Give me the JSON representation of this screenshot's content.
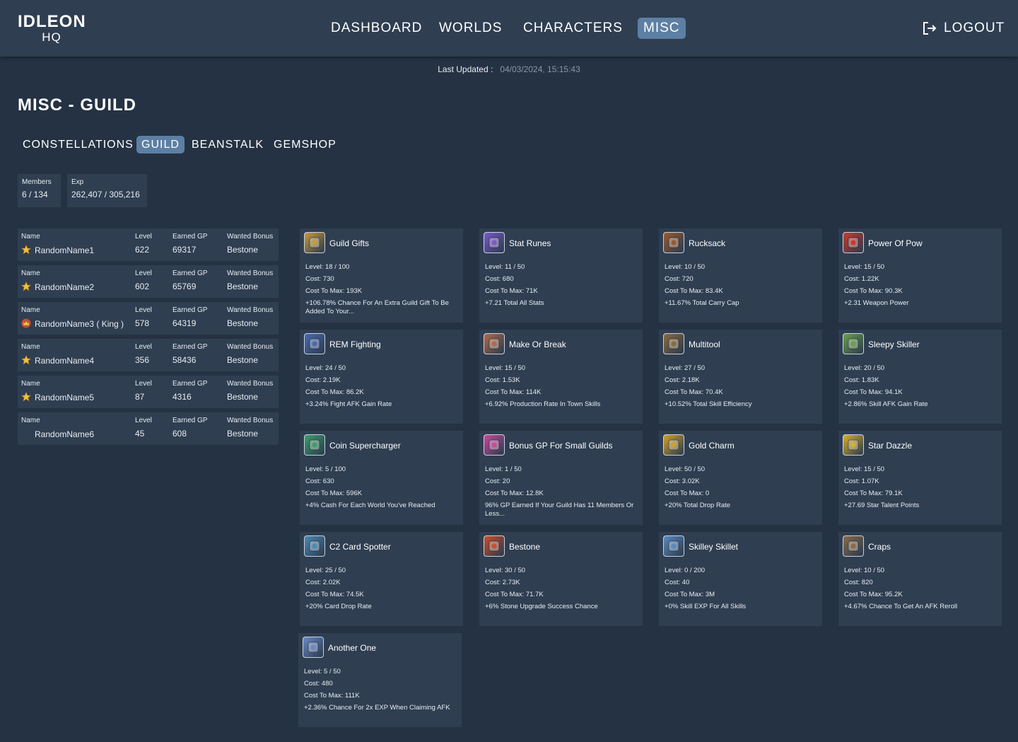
{
  "app": {
    "logo_line1": "IDLEON",
    "logo_line2": "HQ"
  },
  "nav": {
    "items": [
      "DASHBOARD",
      "WORLDS",
      "CHARACTERS",
      "MISC"
    ],
    "active": "MISC",
    "logout": "LOGOUT"
  },
  "last_updated": {
    "label": "Last Updated :",
    "value": "04/03/2024, 15:15:43"
  },
  "page_title": "MISC - GUILD",
  "subtabs": {
    "items": [
      "CONSTELLATIONS",
      "GUILD",
      "BEANSTALK",
      "GEMSHOP"
    ],
    "active": "GUILD"
  },
  "guild_stats": {
    "members_label": "Members",
    "members_value": "6 / 134",
    "exp_label": "Exp",
    "exp_value": "262,407 / 305,216"
  },
  "member_headers": {
    "name": "Name",
    "level": "Level",
    "gp": "Earned GP",
    "bonus": "Wanted Bonus"
  },
  "members": [
    {
      "name": "RandomName1",
      "level": "622",
      "gp": "69317",
      "bonus": "Bestone",
      "rank_icon": "star-icon"
    },
    {
      "name": "RandomName2",
      "level": "602",
      "gp": "65769",
      "bonus": "Bestone",
      "rank_icon": "star-icon"
    },
    {
      "name": "RandomName3 ( King )",
      "level": "578",
      "gp": "64319",
      "bonus": "Bestone",
      "rank_icon": "crown-icon"
    },
    {
      "name": "RandomName4",
      "level": "356",
      "gp": "58436",
      "bonus": "Bestone",
      "rank_icon": "star-icon"
    },
    {
      "name": "RandomName5",
      "level": "87",
      "gp": "4316",
      "bonus": "Bestone",
      "rank_icon": "star-icon"
    },
    {
      "name": "RandomName6",
      "level": "45",
      "gp": "608",
      "bonus": "Bestone",
      "rank_icon": ""
    }
  ],
  "bonuses": [
    {
      "name": "Guild Gifts",
      "level": "Level: 18 / 100",
      "cost": "Cost: 730",
      "cost_to_max": "Cost To Max: 193K",
      "effect": "+106.78% Chance For An Extra Guild Gift To Be Added To Your...",
      "icon": "gift-box-icon",
      "color": "#c99a3a"
    },
    {
      "name": "Stat Runes",
      "level": "Level: 11 / 50",
      "cost": "Cost: 680",
      "cost_to_max": "Cost To Max: 71K",
      "effect": "+7.21 Total All Stats",
      "icon": "rune-stones-icon",
      "color": "#7a5ac8"
    },
    {
      "name": "Rucksack",
      "level": "Level: 10 / 50",
      "cost": "Cost: 720",
      "cost_to_max": "Cost To Max: 83.4K",
      "effect": "+11.67% Total Carry Cap",
      "icon": "backpack-icon",
      "color": "#9a5a2e"
    },
    {
      "name": "Power Of Pow",
      "level": "Level: 15 / 50",
      "cost": "Cost: 1.22K",
      "cost_to_max": "Cost To Max: 90.3K",
      "effect": "+2.31 Weapon Power",
      "icon": "fist-power-icon",
      "color": "#c83a2e"
    },
    {
      "name": "REM Fighting",
      "level": "Level: 24 / 50",
      "cost": "Cost: 2.19K",
      "cost_to_max": "Cost To Max: 86.2K",
      "effect": "+3.24% Fight AFK Gain Rate",
      "icon": "crossed-swords-icon",
      "color": "#4a6ab0"
    },
    {
      "name": "Make Or Break",
      "level": "Level: 15 / 50",
      "cost": "Cost: 1.53K",
      "cost_to_max": "Cost To Max: 114K",
      "effect": "+6.92% Production Rate In Town Skills",
      "icon": "anvil-icon",
      "color": "#b06a4a"
    },
    {
      "name": "Multitool",
      "level": "Level: 27 / 50",
      "cost": "Cost: 2.18K",
      "cost_to_max": "Cost To Max: 70.4K",
      "effect": "+10.52% Total Skill Efficiency",
      "icon": "tools-icon",
      "color": "#8a6a3a"
    },
    {
      "name": "Sleepy Skiller",
      "level": "Level: 20 / 50",
      "cost": "Cost: 1.83K",
      "cost_to_max": "Cost To Max: 94.1K",
      "effect": "+2.86% Skill AFK Gain Rate",
      "icon": "sleep-icon",
      "color": "#6aa04a"
    },
    {
      "name": "Coin Supercharger",
      "level": "Level: 5 / 100",
      "cost": "Cost: 630",
      "cost_to_max": "Cost To Max: 596K",
      "effect": "+4% Cash For Each World You've Reached",
      "icon": "coins-icon",
      "color": "#3aa06a"
    },
    {
      "name": "Bonus GP For Small Guilds",
      "level": "Level: 1 / 50",
      "cost": "Cost: 20",
      "cost_to_max": "Cost To Max: 12.8K",
      "effect": "96% GP Earned If Your Guild Has 11 Members Or Less...",
      "icon": "group-icon",
      "color": "#c84a9a"
    },
    {
      "name": "Gold Charm",
      "level": "Level: 50 / 50",
      "cost": "Cost: 3.02K",
      "cost_to_max": "Cost To Max: 0",
      "effect": "+20% Total Drop Rate",
      "icon": "clover-charm-icon",
      "color": "#d0a02a"
    },
    {
      "name": "Star Dazzle",
      "level": "Level: 15 / 50",
      "cost": "Cost: 1.07K",
      "cost_to_max": "Cost To Max: 79.1K",
      "effect": "+27.69 Star Talent Points",
      "icon": "stars-icon",
      "color": "#d8b02a"
    },
    {
      "name": "C2 Card Spotter",
      "level": "Level: 25 / 50",
      "cost": "Cost: 2.02K",
      "cost_to_max": "Cost To Max: 74.5K",
      "effect": "+20% Card Drop Rate",
      "icon": "cards-icon",
      "color": "#4a8ab0"
    },
    {
      "name": "Bestone",
      "level": "Level: 30 / 50",
      "cost": "Cost: 2.73K",
      "cost_to_max": "Cost To Max: 71.7K",
      "effect": "+6% Stone Upgrade Success Chance",
      "icon": "stone-icon",
      "color": "#c8502e"
    },
    {
      "name": "Skilley Skillet",
      "level": "Level: 0 / 200",
      "cost": "Cost: 40",
      "cost_to_max": "Cost To Max: 3M",
      "effect": "+0% Skill EXP For All Skills",
      "icon": "skillet-icon",
      "color": "#5a8ac0"
    },
    {
      "name": "Craps",
      "level": "Level: 10 / 50",
      "cost": "Cost: 820",
      "cost_to_max": "Cost To Max: 95.2K",
      "effect": "+4.67% Chance To Get An AFK Reroll",
      "icon": "dice-scroll-icon",
      "color": "#8a6a4a"
    },
    {
      "name": "Another One",
      "level": "Level: 5 / 50",
      "cost": "Cost: 480",
      "cost_to_max": "Cost To Max: 111K",
      "effect": "+2.36% Chance For 2x EXP When Claiming AFK",
      "icon": "feather-icon",
      "color": "#6a8ac8"
    }
  ]
}
